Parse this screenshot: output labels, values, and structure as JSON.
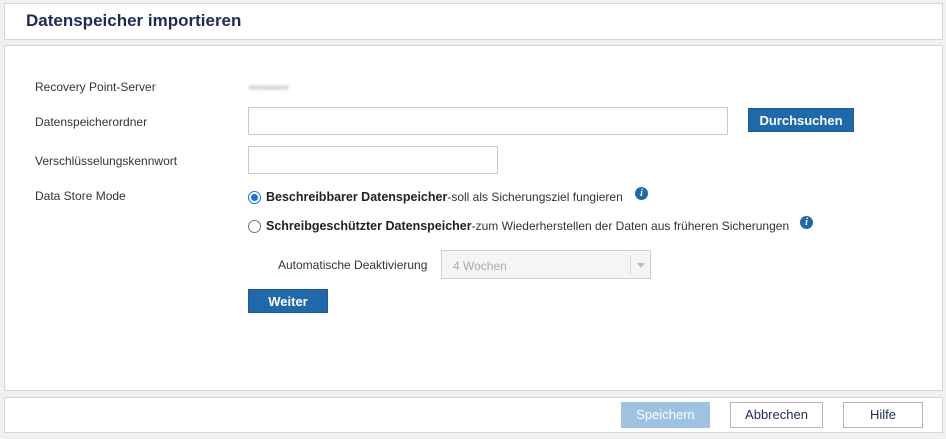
{
  "header": {
    "title": "Datenspeicher importieren"
  },
  "form": {
    "server_label": "Recovery Point-Server",
    "server_value": "▪▪▪▪▪▪▪▪▪",
    "folder_label": "Datenspeicherordner",
    "folder_value": "",
    "browse_label": "Durchsuchen",
    "password_label": "Verschlüsselungskennwort",
    "password_value": "",
    "mode_label": "Data Store Mode",
    "modes": [
      {
        "title": "Beschreibbarer Datenspeicher",
        "desc": " -soll als Sicherungsziel fungieren",
        "selected": true
      },
      {
        "title": "Schreibgeschützter Datenspeicher",
        "desc": "-zum Wiederherstellen der Daten aus früheren Sicherungen",
        "selected": false
      }
    ],
    "auto_deactivate_label": "Automatische Deaktivierung",
    "auto_deactivate_value": "4 Wochen",
    "next_label": "Weiter"
  },
  "footer": {
    "save_label": "Speichern",
    "cancel_label": "Abbrechen",
    "help_label": "Hilfe"
  },
  "icons": {
    "info": "info-icon",
    "dropdown": "chevron-down-icon"
  },
  "colors": {
    "primary": "#1f69ab",
    "title": "#1c2b57",
    "disabled": "#9ec3e2"
  }
}
